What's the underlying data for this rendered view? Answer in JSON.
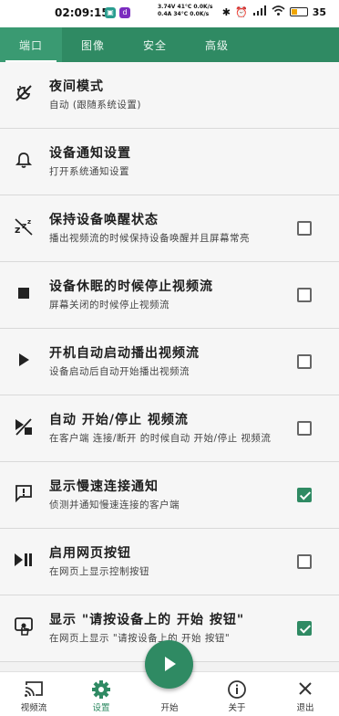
{
  "status": {
    "time": "02:09:15",
    "stats_line1": "3.74V 41°C  0.0K/s",
    "stats_line2": "0.4A  34°C  0.0K/s",
    "battery": "35"
  },
  "tabs": [
    {
      "label": "端口",
      "active": true
    },
    {
      "label": "图像",
      "active": false
    },
    {
      "label": "安全",
      "active": false
    },
    {
      "label": "高级",
      "active": false
    }
  ],
  "settings": [
    {
      "icon": "night-mode-icon",
      "title": "夜间模式",
      "subtitle": "自动 (跟随系统设置)",
      "checkbox": null
    },
    {
      "icon": "bell-icon",
      "title": "设备通知设置",
      "subtitle": "打开系统通知设置",
      "checkbox": null
    },
    {
      "icon": "sleep-zzz-icon",
      "title": "保持设备唤醒状态",
      "subtitle": "播出视频流的时候保持设备唤醒并且屏幕常亮",
      "checkbox": false
    },
    {
      "icon": "stop-icon",
      "title": "设备休眠的时候停止视频流",
      "subtitle": "屏幕关闭的时候停止视频流",
      "checkbox": false
    },
    {
      "icon": "play-icon",
      "title": "开机自动启动播出视频流",
      "subtitle": "设备启动后自动开始播出视频流",
      "checkbox": false
    },
    {
      "icon": "play-stop-icon",
      "title": "自动 开始/停止 视频流",
      "subtitle": "在客户端 连接/断开 的时候自动 开始/停止 视频流",
      "checkbox": false
    },
    {
      "icon": "alert-message-icon",
      "title": "显示慢速连接通知",
      "subtitle": "侦测并通知慢速连接的客户端",
      "checkbox": true
    },
    {
      "icon": "play-pause-icon",
      "title": "启用网页按钮",
      "subtitle": "在网页上显示控制按钮",
      "checkbox": false
    },
    {
      "icon": "touch-screen-icon",
      "title": "显示 \"请按设备上的 开始 按钮\"",
      "subtitle": "在网页上显示 \"请按设备上的 开始 按钮\"",
      "checkbox": true
    }
  ],
  "bottom_nav": [
    {
      "label": "视频流",
      "active": false
    },
    {
      "label": "设置",
      "active": true
    },
    {
      "label": "开始",
      "active": false
    },
    {
      "label": "关于",
      "active": false
    },
    {
      "label": "退出",
      "active": false
    }
  ],
  "colors": {
    "primary": "#2f8a63"
  }
}
